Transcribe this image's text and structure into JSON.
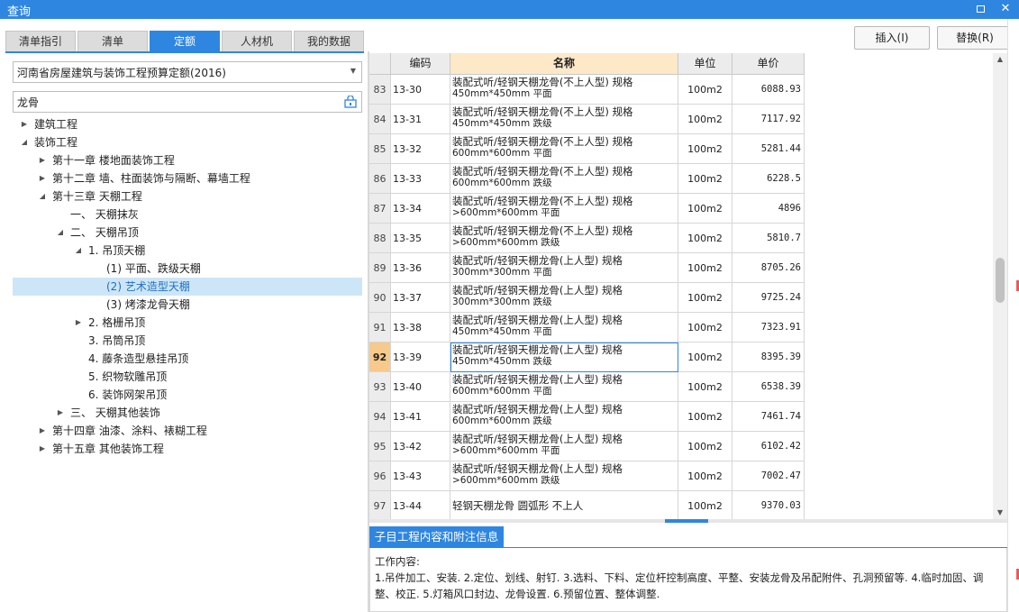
{
  "window": {
    "title": "查询"
  },
  "tabs": [
    {
      "label": "清单指引",
      "active": false
    },
    {
      "label": "清单",
      "active": false
    },
    {
      "label": "定额",
      "active": true
    },
    {
      "label": "人材机",
      "active": false
    },
    {
      "label": "我的数据",
      "active": false
    }
  ],
  "quota_library": {
    "selected": "河南省房屋建筑与装饰工程预算定额(2016)"
  },
  "search": {
    "value": "龙骨"
  },
  "tree": [
    {
      "label": "建筑工程",
      "level": 0,
      "expander": "collapsed"
    },
    {
      "label": "装饰工程",
      "level": 0,
      "expander": "expanded"
    },
    {
      "label": "第十一章 楼地面装饰工程",
      "level": 1,
      "expander": "collapsed"
    },
    {
      "label": "第十二章 墙、柱面装饰与隔断、幕墙工程",
      "level": 1,
      "expander": "collapsed"
    },
    {
      "label": "第十三章 天棚工程",
      "level": 1,
      "expander": "expanded"
    },
    {
      "label": "一、 天棚抹灰",
      "level": 2,
      "expander": "none"
    },
    {
      "label": "二、 天棚吊顶",
      "level": 2,
      "expander": "expanded"
    },
    {
      "label": "1. 吊顶天棚",
      "level": 3,
      "expander": "expanded"
    },
    {
      "label": "(1) 平面、跌级天棚",
      "level": 4,
      "expander": "none"
    },
    {
      "label": "(2) 艺术造型天棚",
      "level": 4,
      "expander": "none",
      "selected": true
    },
    {
      "label": "(3) 烤漆龙骨天棚",
      "level": 4,
      "expander": "none"
    },
    {
      "label": "2. 格栅吊顶",
      "level": 3,
      "expander": "collapsed"
    },
    {
      "label": "3. 吊筒吊顶",
      "level": 3,
      "expander": "none"
    },
    {
      "label": "4. 藤条造型悬挂吊顶",
      "level": 3,
      "expander": "none"
    },
    {
      "label": "5. 织物软雕吊顶",
      "level": 3,
      "expander": "none"
    },
    {
      "label": "6. 装饰网架吊顶",
      "level": 3,
      "expander": "none"
    },
    {
      "label": "三、 天棚其他装饰",
      "level": 2,
      "expander": "collapsed"
    },
    {
      "label": "第十四章 油漆、涂料、裱糊工程",
      "level": 1,
      "expander": "collapsed"
    },
    {
      "label": "第十五章 其他装饰工程",
      "level": 1,
      "expander": "collapsed"
    }
  ],
  "buttons": {
    "insert": "插入(I)",
    "replace": "替换(R)"
  },
  "table": {
    "columns": {
      "code": "编码",
      "name": "名称",
      "unit": "单位",
      "price": "单价"
    },
    "current_row": "92",
    "rows": [
      {
        "idx": "83",
        "code": "13-30",
        "name1": "装配式听/轻钢天棚龙骨(不上人型) 规格",
        "name2": "450mm*450mm 平面",
        "unit": "100m2",
        "price": "6088.93"
      },
      {
        "idx": "84",
        "code": "13-31",
        "name1": "装配式听/轻钢天棚龙骨(不上人型) 规格",
        "name2": "450mm*450mm 跌级",
        "unit": "100m2",
        "price": "7117.92"
      },
      {
        "idx": "85",
        "code": "13-32",
        "name1": "装配式听/轻钢天棚龙骨(不上人型) 规格",
        "name2": "600mm*600mm 平面",
        "unit": "100m2",
        "price": "5281.44"
      },
      {
        "idx": "86",
        "code": "13-33",
        "name1": "装配式听/轻钢天棚龙骨(不上人型) 规格",
        "name2": "600mm*600mm 跌级",
        "unit": "100m2",
        "price": "6228.5"
      },
      {
        "idx": "87",
        "code": "13-34",
        "name1": "装配式听/轻钢天棚龙骨(不上人型) 规格",
        "name2": ">600mm*600mm 平面",
        "unit": "100m2",
        "price": "4896"
      },
      {
        "idx": "88",
        "code": "13-35",
        "name1": "装配式听/轻钢天棚龙骨(不上人型) 规格",
        "name2": ">600mm*600mm 跌级",
        "unit": "100m2",
        "price": "5810.7"
      },
      {
        "idx": "89",
        "code": "13-36",
        "name1": "装配式听/轻钢天棚龙骨(上人型) 规格",
        "name2": "300mm*300mm 平面",
        "unit": "100m2",
        "price": "8705.26"
      },
      {
        "idx": "90",
        "code": "13-37",
        "name1": "装配式听/轻钢天棚龙骨(上人型) 规格",
        "name2": "300mm*300mm 跌级",
        "unit": "100m2",
        "price": "9725.24"
      },
      {
        "idx": "91",
        "code": "13-38",
        "name1": "装配式听/轻钢天棚龙骨(上人型) 规格",
        "name2": "450mm*450mm 平面",
        "unit": "100m2",
        "price": "7323.91"
      },
      {
        "idx": "92",
        "code": "13-39",
        "name1": "装配式听/轻钢天棚龙骨(上人型) 规格",
        "name2": "450mm*450mm 跌级",
        "unit": "100m2",
        "price": "8395.39"
      },
      {
        "idx": "93",
        "code": "13-40",
        "name1": "装配式听/轻钢天棚龙骨(上人型) 规格",
        "name2": "600mm*600mm 平面",
        "unit": "100m2",
        "price": "6538.39"
      },
      {
        "idx": "94",
        "code": "13-41",
        "name1": "装配式听/轻钢天棚龙骨(上人型) 规格",
        "name2": "600mm*600mm 跌级",
        "unit": "100m2",
        "price": "7461.74"
      },
      {
        "idx": "95",
        "code": "13-42",
        "name1": "装配式听/轻钢天棚龙骨(上人型) 规格",
        "name2": ">600mm*600mm 平面",
        "unit": "100m2",
        "price": "6102.42"
      },
      {
        "idx": "96",
        "code": "13-43",
        "name1": "装配式听/轻钢天棚龙骨(上人型) 规格",
        "name2": ">600mm*600mm 跌级",
        "unit": "100m2",
        "price": "7002.47"
      },
      {
        "idx": "97",
        "code": "13-44",
        "name1": "轻钢天棚龙骨 圆弧形 不上人",
        "name2": "",
        "unit": "100m2",
        "price": "9370.03"
      }
    ]
  },
  "info_panel": {
    "tab": "子目工程内容和附注信息",
    "heading": "工作内容:",
    "text": "1.吊件加工、安装. 2.定位、划线、射钉. 3.选料、下料、定位杆控制高度、平整、安装龙骨及吊配附件、孔洞预留等. 4.临时加固、调整、校正. 5.灯箱风口封边、龙骨设置. 6.预留位置、整体调整."
  }
}
